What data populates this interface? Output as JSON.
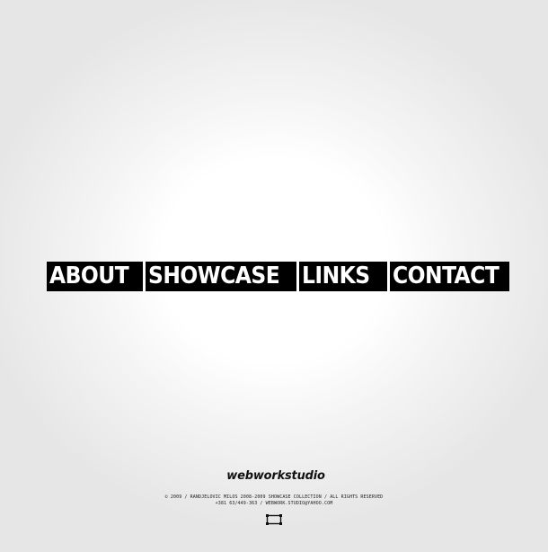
{
  "nav": {
    "about": "ABOUT",
    "showcase": "SHOWCASE",
    "links": "LINKS",
    "contact": "CONTACT"
  },
  "footer": {
    "logo": "webworkstudio",
    "copyright": "© 2009 / RANDJELOVIC MILOS 2008-2009 SHOWCASE COLLECTION / ALL RIGHTS RESERVED",
    "contact": "+381 63/449-363 / WEBWORK.STUDIO@YAHOO.COM"
  },
  "icons": {
    "home": "frame-icon"
  },
  "colors": {
    "nav_background": "#000000",
    "nav_text": "#ffffff",
    "page_background": "#ffffff"
  }
}
